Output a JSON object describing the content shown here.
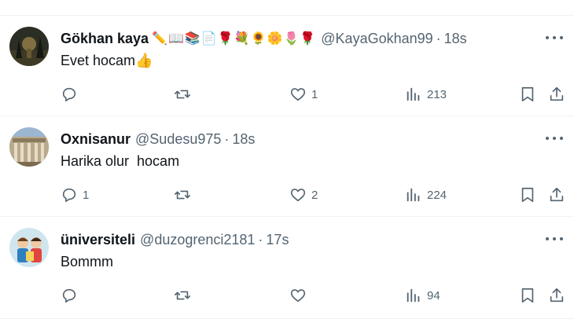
{
  "tweets": [
    {
      "name": "Gökhan kaya",
      "emojis": "✏️📖📚📄🌹💐🌻🌼🌷🌹",
      "handle": "@KayaGokhan99",
      "separator": "·",
      "time": "18s",
      "text": "Evet hocam👍",
      "reply_count": "",
      "retweet_count": "",
      "like_count": "1",
      "view_count": "213"
    },
    {
      "name": "Oxnisanur",
      "emojis": "",
      "handle": "@Sudesu975",
      "separator": "·",
      "time": "18s",
      "text": "Harika olur  hocam",
      "reply_count": "1",
      "retweet_count": "",
      "like_count": "2",
      "view_count": "224"
    },
    {
      "name": "üniversiteli",
      "emojis": "",
      "handle": "@duzogrenci2181",
      "separator": "·",
      "time": "17s",
      "text": "Bommm",
      "reply_count": "",
      "retweet_count": "",
      "like_count": "",
      "view_count": "94"
    }
  ],
  "icons": {
    "reply": "reply-icon",
    "retweet": "retweet-icon",
    "like": "heart-icon",
    "views": "views-chart-icon",
    "bookmark": "bookmark-icon",
    "share": "share-icon",
    "more": "more-options-icon"
  },
  "colors": {
    "text": "#0f1419",
    "secondary": "#536471",
    "divider": "#eff3f4"
  }
}
